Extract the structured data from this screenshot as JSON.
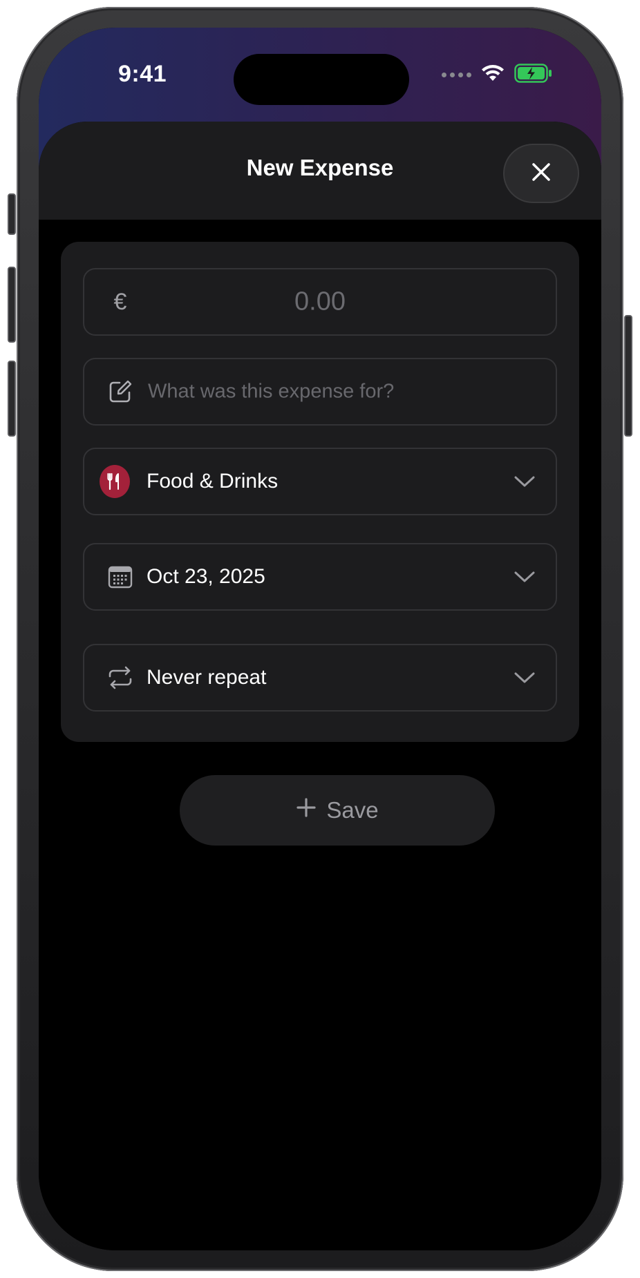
{
  "status_bar": {
    "time": "9:41"
  },
  "sheet": {
    "title": "New Expense"
  },
  "form": {
    "amount": {
      "currency_symbol": "€",
      "placeholder": "0.00",
      "value": ""
    },
    "description": {
      "placeholder": "What was this expense for?",
      "value": ""
    },
    "category": {
      "label": "Food & Drinks",
      "badge_color": "#a3213a",
      "icon": "fork-knife-icon"
    },
    "date": {
      "label": "Oct 23, 2025",
      "icon": "calendar-icon"
    },
    "repeat": {
      "label": "Never repeat",
      "icon": "repeat-icon"
    }
  },
  "actions": {
    "save_label": "Save"
  },
  "colors": {
    "background": "#000000",
    "card": "#1c1c1e",
    "field_border": "#333336",
    "battery_green": "#34c759",
    "category_red": "#a3213a"
  }
}
